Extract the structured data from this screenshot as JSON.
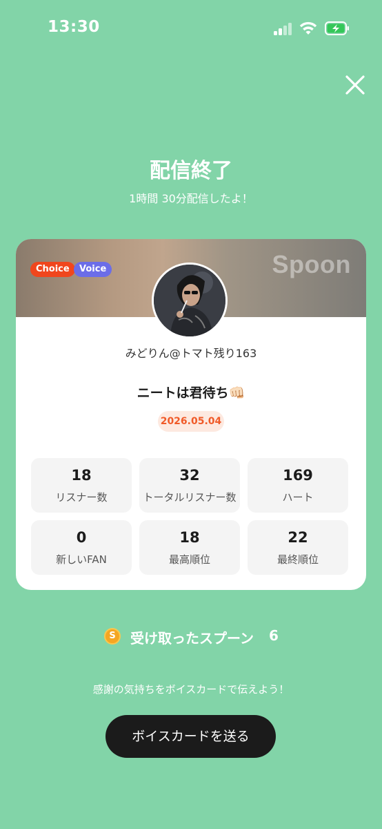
{
  "status_bar": {
    "time": "13:30"
  },
  "header": {
    "title": "配信終了",
    "subtitle": "1時間 30分配信したよ！"
  },
  "card": {
    "brand": "Spoon",
    "badges": [
      "Choice",
      "Voice"
    ],
    "username": "みどりん@トマト残り163",
    "room_title": "ニートは君待ち👊🏻",
    "date": "2026.05.04",
    "stats": [
      {
        "value": "18",
        "label": "リスナー数"
      },
      {
        "value": "32",
        "label": "トータルリスナー数"
      },
      {
        "value": "169",
        "label": "ハート"
      },
      {
        "value": "0",
        "label": "新しいFAN"
      },
      {
        "value": "18",
        "label": "最高順位"
      },
      {
        "value": "22",
        "label": "最終順位"
      }
    ]
  },
  "spoons": {
    "coin_glyph": "S",
    "label": "受け取ったスプーン",
    "count": "6"
  },
  "footer": {
    "thanks_text": "感謝の気持ちをボイスカードで伝えよう！",
    "cta_label": "ボイスカードを送る"
  },
  "colors": {
    "background": "#82d4a8",
    "choice_badge": "#f0461d",
    "voice_badge": "#6b6de8",
    "date_text": "#f05a28",
    "button": "#1b1b1b"
  }
}
